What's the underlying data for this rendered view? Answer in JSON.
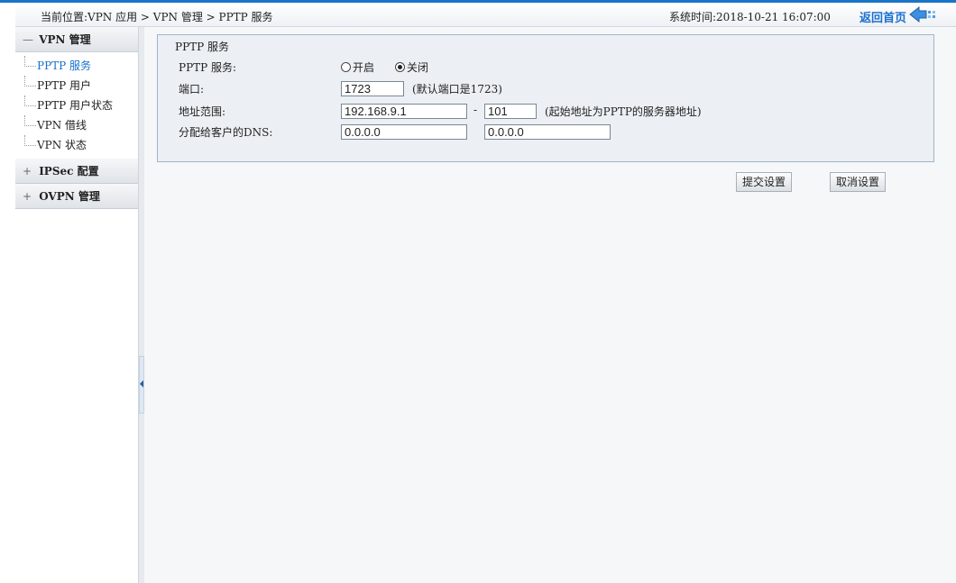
{
  "header": {
    "breadcrumb": "当前位置:VPN 应用 > VPN 管理 > PPTP 服务",
    "system_time": "系统时间:2018-10-21 16:07:00",
    "home_link": "返回首页"
  },
  "sidebar": {
    "groups": [
      {
        "toggle": "—",
        "title": "VPN 管理",
        "items": [
          {
            "label": "PPTP 服务"
          },
          {
            "label": "PPTP 用户"
          },
          {
            "label": "PPTP 用户状态"
          },
          {
            "label": "VPN 借线"
          },
          {
            "label": "VPN 状态"
          }
        ]
      },
      {
        "toggle": "+",
        "title": "IPSec 配置"
      },
      {
        "toggle": "+",
        "title": "OVPN 管理"
      }
    ]
  },
  "form": {
    "title": "PPTP 服务",
    "service_label": "PPTP 服务:",
    "opt_on": "开启",
    "opt_off": "关闭",
    "selected": "关闭",
    "port_label": "端口:",
    "port_value": "1723",
    "port_hint": "(默认端口是1723)",
    "range_label": "地址范围:",
    "range_start": "192.168.9.1",
    "range_dash": "-",
    "range_end": "101",
    "range_hint": "(起始地址为PPTP的服务器地址)",
    "dns_label": "分配给客户的DNS:",
    "dns1": "0.0.0.0",
    "dns2": "0.0.0.0"
  },
  "buttons": {
    "submit": "提交设置",
    "cancel": "取消设置"
  },
  "colors": {
    "accent": "#1a74c7",
    "link": "#1a6fcf",
    "panel_border": "#9fb6cc"
  }
}
